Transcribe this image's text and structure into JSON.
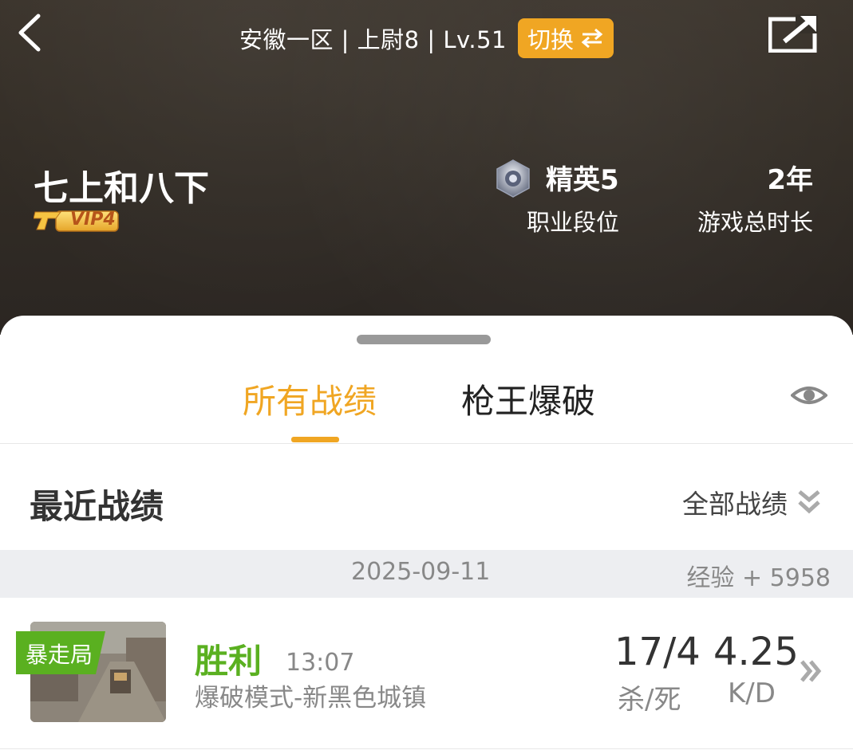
{
  "header": {
    "server_info": "安徽一区 | 上尉8 | Lv.51",
    "switch_label": "切换",
    "player_name": "七上和八下",
    "vip_label": "VIP4",
    "rank_value": "精英5",
    "rank_label": "职业段位",
    "play_time_value": "2年",
    "play_time_label": "游戏总时长"
  },
  "tabs": [
    {
      "label": "所有战绩",
      "active": true
    },
    {
      "label": "枪王爆破",
      "active": false
    }
  ],
  "recent": {
    "title": "最近战绩",
    "filter_label": "全部战绩"
  },
  "date_group": {
    "date": "2025-09-11",
    "exp": "经验 + 5958"
  },
  "matches": [
    {
      "mode_tag": "暴走局",
      "result": "胜利",
      "time": "13:07",
      "map": "爆破模式-新黑色城镇",
      "kills_deaths": "17/4",
      "kd_label": "杀/死",
      "kd": "4.25",
      "kd_ratio_label": "K/D"
    }
  ],
  "colors": {
    "accent": "#f0a623",
    "victory": "#5ab020",
    "header_bg": "#332d26"
  },
  "icons": [
    "back-arrow-icon",
    "swap-icon",
    "share-icon",
    "rank-emblem-icon",
    "eye-icon",
    "double-chevron-down-icon",
    "double-chevron-right-icon"
  ]
}
